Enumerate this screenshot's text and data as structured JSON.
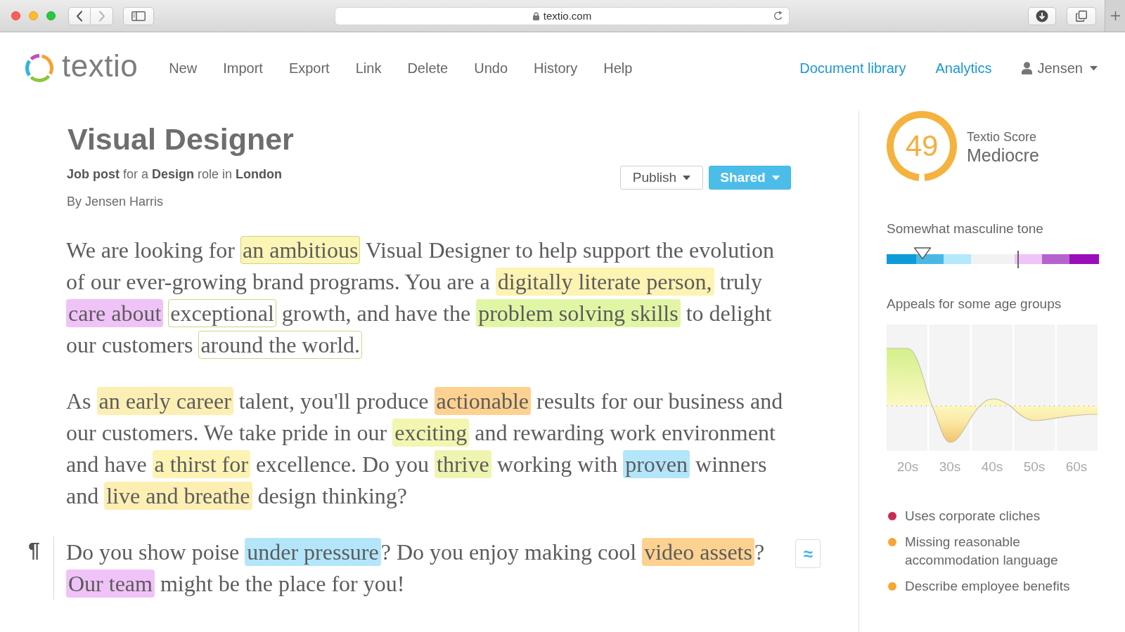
{
  "browser": {
    "nav": [
      {
        "kind": "back",
        "disabled": false
      },
      {
        "kind": "forward",
        "disabled": true
      }
    ],
    "url": "textio.com"
  },
  "header": {
    "logo_text": "textio",
    "menu": [
      "New",
      "Import",
      "Export",
      "Link",
      "Delete",
      "Undo",
      "History",
      "Help"
    ],
    "links": [
      "Document library",
      "Analytics"
    ],
    "user": "Jensen"
  },
  "document": {
    "title": "Visual Designer",
    "subtitle": "**Job post** for a **Design** role in **London**",
    "byline": "By Jensen Harris",
    "actions": [
      {
        "label": "Publish",
        "kind": "outline"
      },
      {
        "label": "Shared",
        "kind": "primary"
      }
    ],
    "paragraphs": [
      {
        "segments": [
          {
            "text": "We are looking for ",
            "kind": "plain"
          },
          {
            "text": "an ambitious",
            "kind": "outlined-mark",
            "color": "#fcf5b6"
          },
          {
            "text": " Visual Designer to help support the evolution of our ever-growing brand programs. You are a ",
            "kind": "plain"
          },
          {
            "text": "digitally literate person,",
            "kind": "mark",
            "color": "#fdf3b2"
          },
          {
            "text": " truly ",
            "kind": "plain"
          },
          {
            "text": "care about",
            "kind": "mark",
            "color": "#f0c3f8"
          },
          {
            "text": "exceptional",
            "kind": "outline"
          },
          {
            "text": " growth, and have the ",
            "kind": "plain"
          },
          {
            "text": "problem solving skills",
            "kind": "mark",
            "color": "#e1f6a4"
          },
          {
            "text": " to delight our customers ",
            "kind": "plain"
          },
          {
            "text": "around the world.",
            "kind": "outline"
          }
        ]
      },
      {
        "segments": [
          {
            "text": "As ",
            "kind": "plain"
          },
          {
            "text": "an early career",
            "kind": "mark",
            "color": "#fdefb4"
          },
          {
            "text": " talent, you'll produce ",
            "kind": "plain"
          },
          {
            "text": "actionable",
            "kind": "mark",
            "color": "#fdd291"
          },
          {
            "text": " results for our business and our customers. We take pride in our ",
            "kind": "plain"
          },
          {
            "text": "exciting",
            "kind": "mark",
            "color": "#f3f6b0"
          },
          {
            "text": " and rewarding work environment and have ",
            "kind": "plain"
          },
          {
            "text": "a thirst for",
            "kind": "mark",
            "color": "#fdf3b4"
          },
          {
            "text": " excellence. Do you ",
            "kind": "plain"
          },
          {
            "text": "thrive",
            "kind": "mark",
            "color": "#eff5b0"
          },
          {
            "text": " working with ",
            "kind": "plain"
          },
          {
            "text": "proven",
            "kind": "mark",
            "color": "#b4e6fb"
          },
          {
            "text": " winners and ",
            "kind": "plain"
          },
          {
            "text": "live and breathe",
            "kind": "mark",
            "color": "#fdeeb2"
          },
          {
            "text": " design thinking?",
            "kind": "plain"
          }
        ]
      },
      {
        "pilcrow": "¶",
        "side_button": "≈",
        "segments": [
          {
            "text": "Do you show poise ",
            "kind": "plain"
          },
          {
            "text": "under pressure",
            "kind": "mark",
            "color": "#b4e6fb"
          },
          {
            "text": "? Do you enjoy making cool ",
            "kind": "plain"
          },
          {
            "text": "video assets",
            "kind": "mark",
            "color": "#fdd291"
          },
          {
            "text": "? ",
            "kind": "plain"
          },
          {
            "text": "Our team",
            "kind": "mark",
            "color": "#f0c3f8"
          },
          {
            "text": " might be the place for you!",
            "kind": "plain"
          }
        ]
      }
    ]
  },
  "insights": {
    "score": {
      "value": "49",
      "label": "Textio Score",
      "rating": "Mediocre"
    },
    "tone": {
      "label": "Somewhat masculine tone",
      "markers": [
        {
          "kind": "pointer",
          "level": 0.17
        },
        {
          "kind": "tick",
          "level": 0.62
        }
      ]
    },
    "age_appeal": {
      "title": "Appeals for some age groups",
      "groups": [
        "20s",
        "30s",
        "40s",
        "50s",
        "60s"
      ]
    },
    "issues": [
      {
        "text": "Uses corporate cliches",
        "color": "#cc2b50"
      },
      {
        "text": "Missing reasonable accommodation language",
        "color": "#f5a734"
      },
      {
        "text": "Describe employee benefits",
        "color": "#f5a734"
      }
    ]
  }
}
